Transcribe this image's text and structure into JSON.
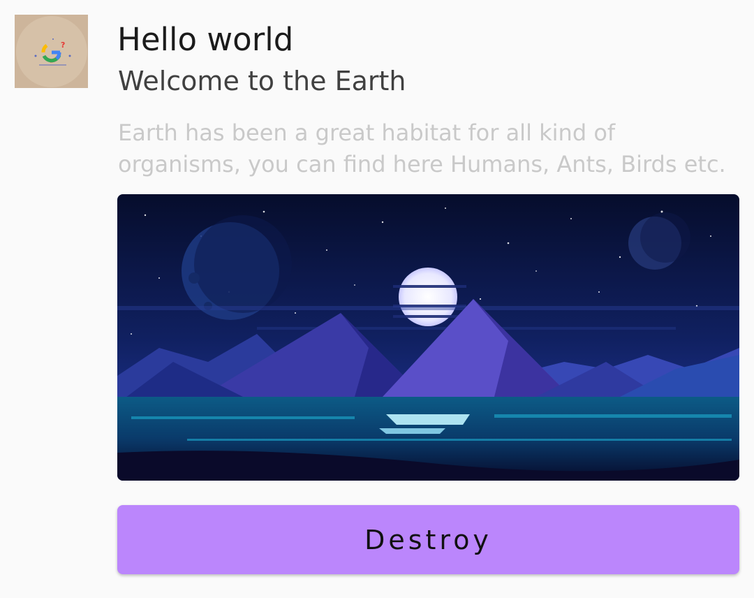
{
  "card": {
    "title": "Hello world",
    "subtitle": "Welcome to the Earth",
    "description": "Earth has been a great habitat for all kind of organisms, you can find here Humans, Ants, Birds etc.",
    "avatar_icon": "google-question-icon",
    "hero_image_icon": "night-mountain-landscape-image",
    "button_label": "Destroy"
  },
  "colors": {
    "background": "#fafafa",
    "button": "#bb86fc",
    "title": "#1b1b1b",
    "subtitle": "#404040",
    "description": "#c9c9c9",
    "avatar_bg": "#cdb59b"
  }
}
